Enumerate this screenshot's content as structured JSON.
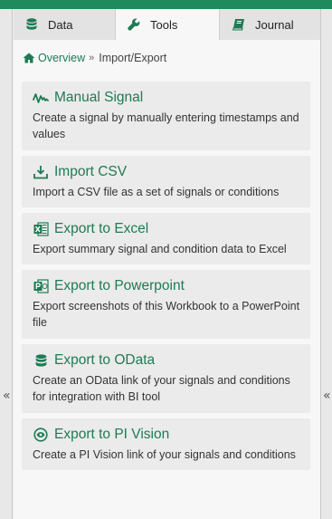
{
  "tabs": [
    {
      "label": "Data",
      "icon": "database-icon"
    },
    {
      "label": "Tools",
      "icon": "wrench-icon",
      "active": true
    },
    {
      "label": "Journal",
      "icon": "book-icon"
    }
  ],
  "breadcrumb": {
    "home_label": "Overview",
    "separator": "»",
    "current": "Import/Export"
  },
  "tools": [
    {
      "title": "Manual Signal",
      "description": "Create a signal by manually entering timestamps and values",
      "icon": "signal-wave-icon"
    },
    {
      "title": "Import CSV",
      "description": "Import a CSV file as a set of signals or conditions",
      "icon": "download-tray-icon"
    },
    {
      "title": "Export to Excel",
      "description": "Export summary signal and condition data to Excel",
      "icon": "excel-icon"
    },
    {
      "title": "Export to Powerpoint",
      "description": "Export screenshots of this Workbook to a PowerPoint file",
      "icon": "powerpoint-icon"
    },
    {
      "title": "Export to OData",
      "description": "Create an OData link of your signals and conditions for integration with BI tool",
      "icon": "database-icon"
    },
    {
      "title": "Export to PI Vision",
      "description": "Create a PI Vision link of your signals and conditions",
      "icon": "pi-vision-icon"
    }
  ],
  "collapse_glyph": "«",
  "colors": {
    "accent": "#1f7a55",
    "topbar": "#1f8a5e"
  }
}
